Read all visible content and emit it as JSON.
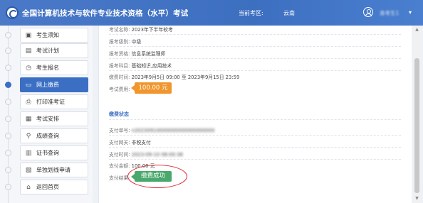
{
  "header": {
    "title": "全国计算机技术与软件专业技术资格（水平）考试",
    "region_label": "当前考区:",
    "region_value": "云南",
    "user_name": "准考生1",
    "caret": "▾"
  },
  "sidebar": {
    "items": [
      {
        "label": "考生须知",
        "icon": "▣",
        "active": false
      },
      {
        "label": "考试计划",
        "icon": "▤",
        "active": false
      },
      {
        "label": "考生报名",
        "icon": "◷",
        "active": false
      },
      {
        "label": "网上缴费",
        "icon": "▭",
        "active": true
      },
      {
        "label": "打印准考证",
        "icon": "⎙",
        "active": false
      },
      {
        "label": "考试安排",
        "icon": "▦",
        "active": false
      },
      {
        "label": "成绩查询",
        "icon": "⚲",
        "active": false
      },
      {
        "label": "证书查询",
        "icon": "▥",
        "active": false
      },
      {
        "label": "单独划线申请",
        "icon": "▧",
        "active": false
      },
      {
        "label": "返回首页",
        "icon": "⌂",
        "active": false
      }
    ]
  },
  "exam_info": {
    "name_label": "考试名称:",
    "name_value": "2023年下半年软考",
    "level_label": "报考级别:",
    "level_value": "中级",
    "qual_label": "报考资格:",
    "qual_value": "信息系统监理师",
    "subject_label": "报考科目:",
    "subject_value": "基础知识,应用技术",
    "time_label": "缴费时间:",
    "time_value": "2023年9月5日 09:00 至 2023年9月15日 23:59",
    "fee_label": "考试费用:",
    "fee_value": "100.00 元"
  },
  "payment": {
    "section_title": "缴费状态",
    "order_label": "支付单号:",
    "order_value": "n20230910000000000000000000",
    "gateway_label": "支付网关:",
    "gateway_value": "非税支付",
    "paytime_label": "支付时间:",
    "paytime_value": "2023-09-10 08:00:38",
    "amount_label": "支付金额:",
    "amount_value": "100.00 元",
    "result_label": "支付结果:",
    "result_value": "缴费成功"
  },
  "colors": {
    "header": "#3d6fc0",
    "active_nav": "#3b6fc4",
    "fee_badge": "#f0962c",
    "success_badge": "#49a86b",
    "highlight": "#d9262c"
  }
}
